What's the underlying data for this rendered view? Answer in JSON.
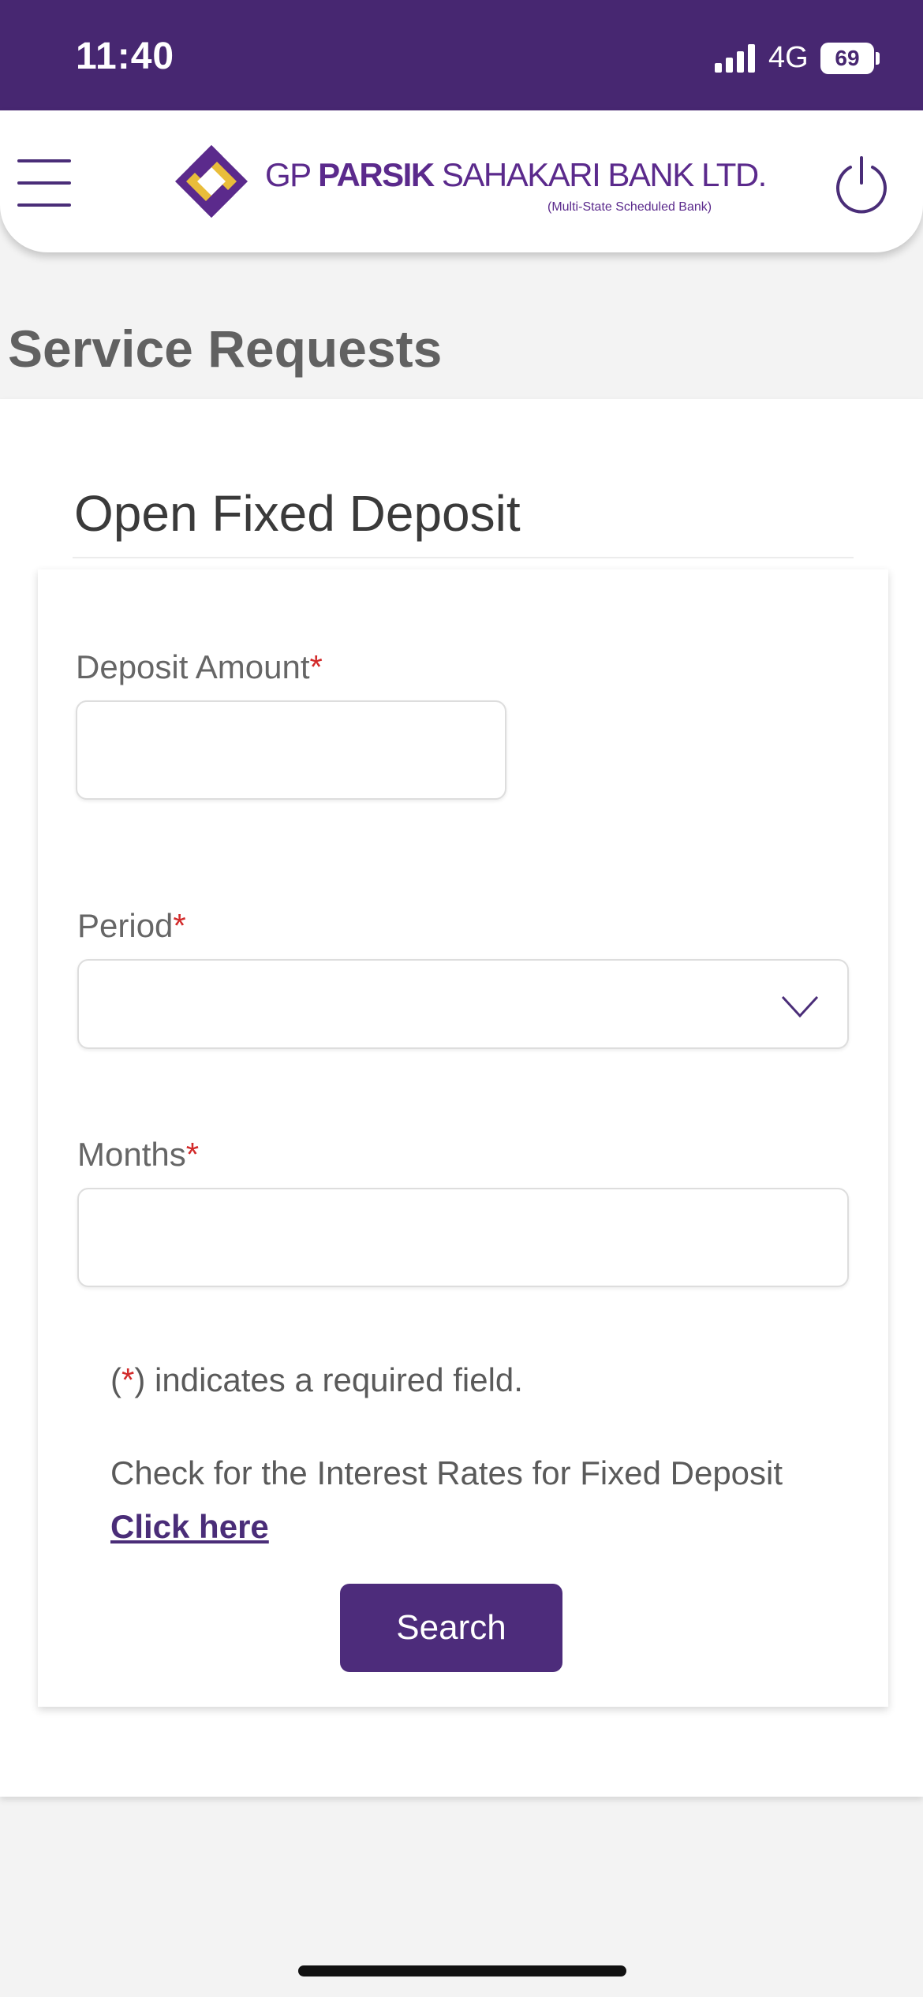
{
  "status_bar": {
    "time": "11:40",
    "network": "4G",
    "battery": "69"
  },
  "header": {
    "bank_prefix": "GP ",
    "bank_bold": "PARSIK",
    "bank_suffix": " SAHAKARI BANK LTD.",
    "tagline": "(Multi-State Scheduled Bank)",
    "icons": [
      "menu-icon",
      "logo-mark",
      "power-icon"
    ],
    "brand_color": "#472771",
    "logo_accent": "#e9bd3a"
  },
  "page": {
    "title": "Service Requests"
  },
  "form": {
    "title": "Open Fixed Deposit",
    "deposit_amount": {
      "label": "Deposit Amount",
      "value": ""
    },
    "period": {
      "label": "Period",
      "selected": ""
    },
    "months": {
      "label": "Months",
      "value": ""
    },
    "required_marker": "*",
    "note_open": "(",
    "note_close": ") indicates a required field.",
    "rates_text": "Check for the Interest Rates for Fixed Deposit",
    "rates_link": "Click here",
    "search_label": "Search"
  }
}
